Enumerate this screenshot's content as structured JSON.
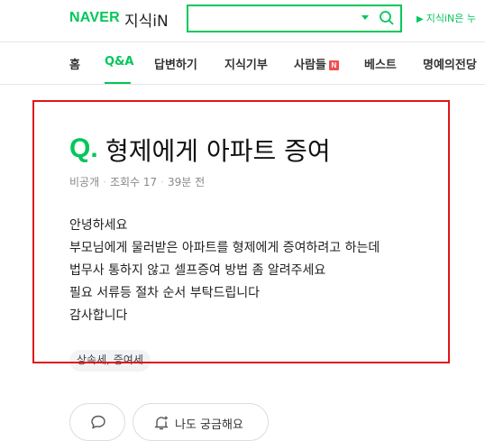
{
  "header": {
    "logo": "NAVER",
    "service": "지식iN",
    "search": {
      "value": "",
      "placeholder": ""
    },
    "notice": "지식iN은 누"
  },
  "nav": {
    "items": [
      {
        "label": "홈"
      },
      {
        "label": "Q&A"
      },
      {
        "label": "답변하기"
      },
      {
        "label": "지식기부"
      },
      {
        "label": "사람들"
      },
      {
        "label": "베스트"
      },
      {
        "label": "명예의전당"
      }
    ],
    "active": "Q&A",
    "new_badge": "N"
  },
  "question": {
    "mark": "Q.",
    "title": "형제에게 아파트 증여",
    "meta": {
      "visibility": "비공개",
      "views": "조회수 17",
      "time": "39분 전"
    },
    "body": [
      "안녕하세요",
      "부모님에게 물러받은 아파트를 형제에게 증여하려고 하는데",
      "법무사 통하지 않고 셀프증여 방법 좀 알려주세요",
      "필요 서류등 절차 순서 부탁드립니다",
      "감사합니다"
    ],
    "tag": "상속세, 증여세"
  },
  "actions": {
    "curious_label": "나도 궁금해요"
  },
  "colors": {
    "brand": "#03c75a",
    "highlight": "#e0141a",
    "badge": "#f04e4e"
  }
}
